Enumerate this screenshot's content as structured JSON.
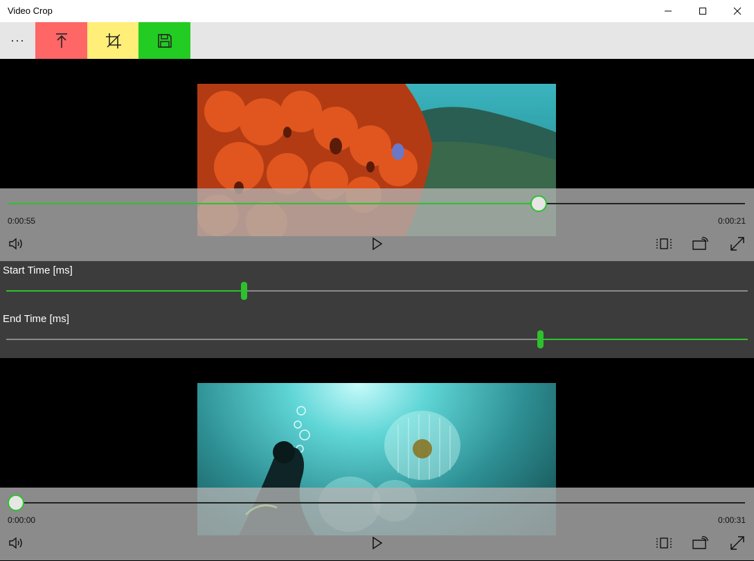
{
  "window": {
    "title": "Video Crop"
  },
  "toolbar": {
    "more_label": "···",
    "colors": {
      "upload": "#ff6666",
      "crop": "#ffee77",
      "save": "#22cc22"
    },
    "icons": [
      "upload-icon",
      "crop-icon",
      "save-icon"
    ]
  },
  "player_top": {
    "elapsed": "0:00:55",
    "remaining": "0:00:21",
    "progress": 0.72
  },
  "range": {
    "start_label": "Start Time [ms]",
    "end_label": "End Time  [ms]",
    "start_fraction": 0.32,
    "end_fraction": 0.72
  },
  "player_bottom": {
    "elapsed": "0:00:00",
    "remaining": "0:00:31",
    "progress": 0.01
  },
  "accent": "#2ec12e"
}
